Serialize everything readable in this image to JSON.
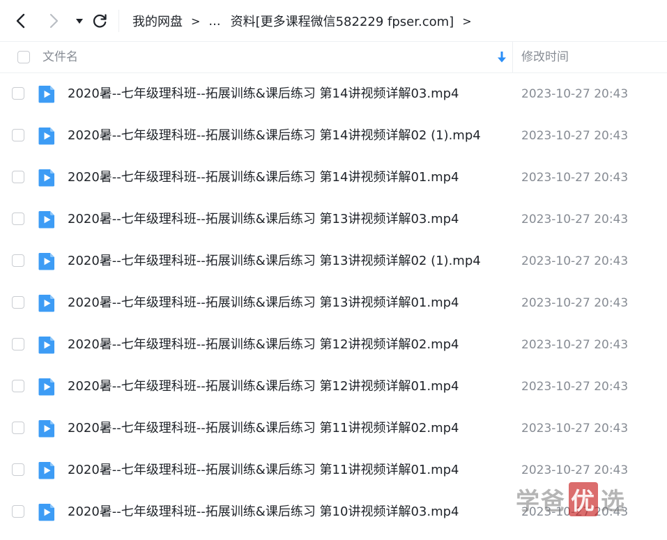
{
  "nav": {
    "back_icon": "chevron-left-icon",
    "forward_icon": "chevron-right-icon",
    "dropdown_icon": "caret-down-icon",
    "refresh_icon": "refresh-icon"
  },
  "breadcrumb": {
    "root": "我的网盘",
    "separator": ">",
    "ellipsis": "...",
    "current": "资料[更多课程微信582229 fpser.com]"
  },
  "header": {
    "name_label": "文件名",
    "time_label": "修改时间",
    "sort_icon": "sort-down-arrow-icon",
    "sort_color": "#2b8ef7"
  },
  "files": [
    {
      "name": "2020暑--七年级理科班--拓展训练&课后练习 第14讲视频详解03.mp4",
      "modified": "2023-10-27 20:43"
    },
    {
      "name": "2020暑--七年级理科班--拓展训练&课后练习 第14讲视频详解02 (1).mp4",
      "modified": "2023-10-27 20:43"
    },
    {
      "name": "2020暑--七年级理科班--拓展训练&课后练习 第14讲视频详解01.mp4",
      "modified": "2023-10-27 20:43"
    },
    {
      "name": "2020暑--七年级理科班--拓展训练&课后练习 第13讲视频详解03.mp4",
      "modified": "2023-10-27 20:43"
    },
    {
      "name": "2020暑--七年级理科班--拓展训练&课后练习 第13讲视频详解02 (1).mp4",
      "modified": "2023-10-27 20:43"
    },
    {
      "name": "2020暑--七年级理科班--拓展训练&课后练习 第13讲视频详解01.mp4",
      "modified": "2023-10-27 20:43"
    },
    {
      "name": "2020暑--七年级理科班--拓展训练&课后练习 第12讲视频详解02.mp4",
      "modified": "2023-10-27 20:43"
    },
    {
      "name": "2020暑--七年级理科班--拓展训练&课后练习 第12讲视频详解01.mp4",
      "modified": "2023-10-27 20:43"
    },
    {
      "name": "2020暑--七年级理科班--拓展训练&课后练习 第11讲视频详解02.mp4",
      "modified": "2023-10-27 20:43"
    },
    {
      "name": "2020暑--七年级理科班--拓展训练&课后练习 第11讲视频详解01.mp4",
      "modified": "2023-10-27 20:43"
    },
    {
      "name": "2020暑--七年级理科班--拓展训练&课后练习 第10讲视频详解03.mp4",
      "modified": "2023-10-27 20:43"
    }
  ],
  "file_icon": {
    "name": "video-file-icon",
    "color": "#3d9cf5"
  },
  "watermark": {
    "part1": "学爸",
    "highlight": "优",
    "part2": "选"
  }
}
